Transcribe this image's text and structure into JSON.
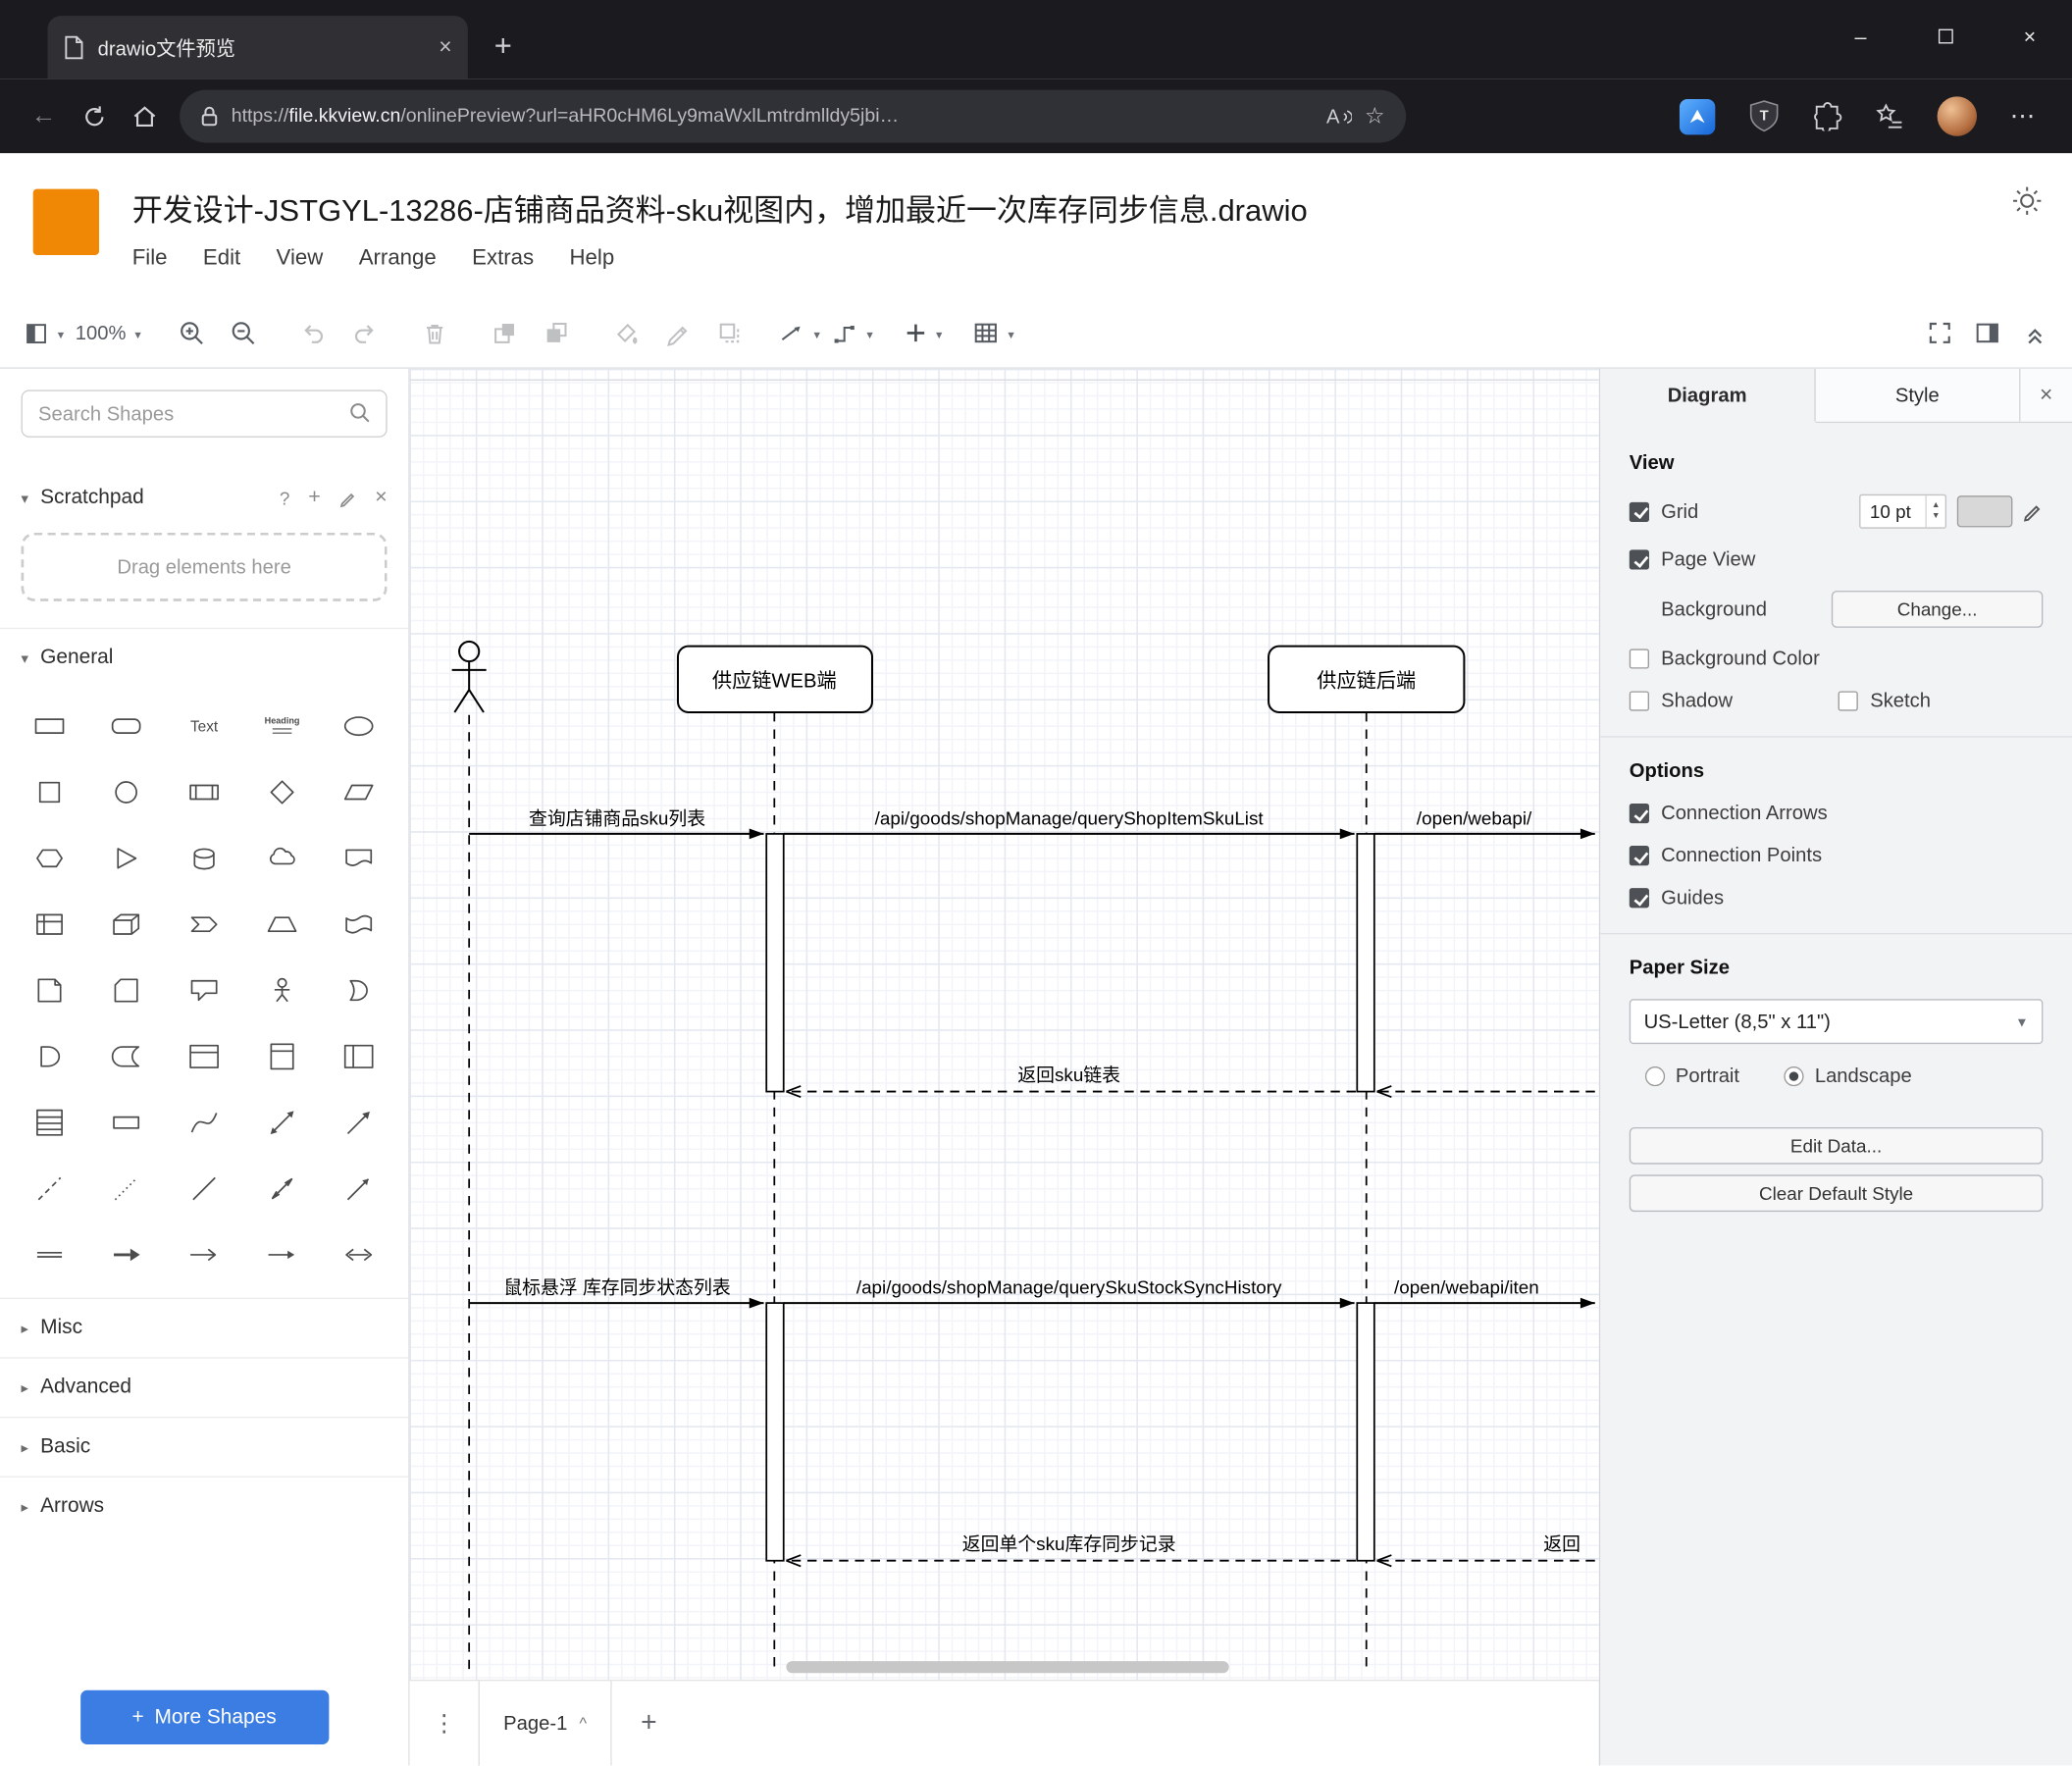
{
  "browser": {
    "tab_title": "drawio文件预览",
    "new_tab": "+",
    "window": {
      "minimize": "–",
      "close": "×"
    },
    "address": {
      "scheme": "https://",
      "host": "file.kkview.cn",
      "path": "/onlinePreview?url=aHR0cHM6Ly9maWxlLmtrdmlldy5jbi…"
    },
    "read_aloud": "A",
    "menu_dots": "⋯"
  },
  "app": {
    "title": "开发设计-JSTGYL-13286-店铺商品资料-sku视图内，增加最近一次库存同步信息.drawio",
    "menus": [
      "File",
      "Edit",
      "View",
      "Arrange",
      "Extras",
      "Help"
    ],
    "toolbar": {
      "zoom": "100%"
    }
  },
  "sidebar": {
    "search_placeholder": "Search Shapes",
    "scratchpad_label": "Scratchpad",
    "scratchpad_help": "?",
    "scratchpad_add": "+",
    "scratchpad_close": "×",
    "scratchpad_hint": "Drag elements here",
    "sections": {
      "general": "General",
      "misc": "Misc",
      "advanced": "Advanced",
      "basic": "Basic",
      "arrows": "Arrows"
    },
    "shapes": [
      "rectangle",
      "rounded-rectangle",
      "text",
      "heading",
      "ellipse",
      "square",
      "circle",
      "process",
      "diamond",
      "parallelogram",
      "hexagon",
      "triangle",
      "cylinder",
      "cloud",
      "document",
      "internal-storage",
      "cube",
      "step",
      "trapezoid",
      "tape",
      "note",
      "card",
      "callout",
      "actor",
      "or",
      "and",
      "data-storage",
      "container",
      "vertical-container",
      "horizontal-container",
      "list",
      "list-item",
      "curve",
      "bidirectional-arrow",
      "arrow",
      "dashed-line",
      "dotted-line",
      "line",
      "bidirectional-connector",
      "directional-connector",
      "link",
      "arrow-simple",
      "arrow-open",
      "arrow-thin",
      "arrow-double"
    ],
    "more_shapes_plus": "+",
    "more_shapes": "More Shapes"
  },
  "canvas": {
    "lifeline_web": "供应链WEB端",
    "lifeline_backend": "供应链后端",
    "msg_query_sku_list": "查询店铺商品sku列表",
    "msg_api_query_shop_item_sku_list": "/api/goods/shopManage/queryShopItemSkuList",
    "msg_open_webapi_1": "/open/webapi/",
    "msg_return_sku_list": "返回sku链表",
    "msg_hover_stock_sync": "鼠标悬浮 库存同步状态列表",
    "msg_api_query_sku_stock_sync_history": "/api/goods/shopManage/querySkuStockSyncHistory",
    "msg_open_webapi_2": "/open/webapi/iten",
    "msg_return_single_sku": "返回单个sku库存同步记录",
    "msg_return_partial": "返回"
  },
  "pagebar": {
    "page": "Page-1",
    "add": "+"
  },
  "panel": {
    "tabs": {
      "diagram": "Diagram",
      "style": "Style",
      "close": "×"
    },
    "view": {
      "heading": "View",
      "grid": "Grid",
      "grid_size": "10 pt",
      "grid_checked": true,
      "page_view": "Page View",
      "page_view_checked": true,
      "background": "Background",
      "change": "Change...",
      "background_color": "Background Color",
      "background_color_checked": false,
      "shadow": "Shadow",
      "shadow_checked": false,
      "sketch": "Sketch",
      "sketch_checked": false
    },
    "options": {
      "heading": "Options",
      "connection_arrows": "Connection Arrows",
      "connection_arrows_checked": true,
      "connection_points": "Connection Points",
      "connection_points_checked": true,
      "guides": "Guides",
      "guides_checked": true
    },
    "paper": {
      "heading": "Paper Size",
      "size": "US-Letter (8,5\" x 11\")",
      "portrait": "Portrait",
      "portrait_selected": false,
      "landscape": "Landscape",
      "landscape_selected": true
    },
    "buttons": {
      "edit_data": "Edit Data...",
      "clear_default_style": "Clear Default Style"
    }
  }
}
